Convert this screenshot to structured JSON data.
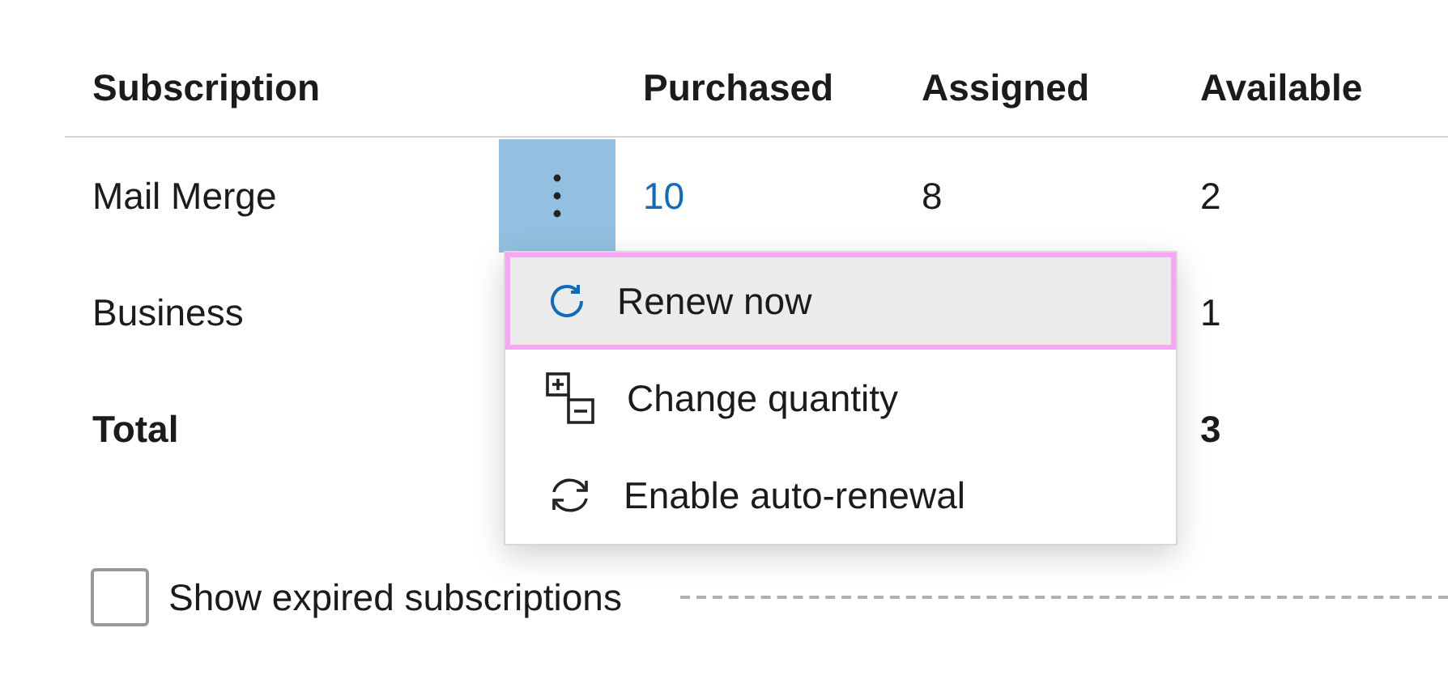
{
  "table": {
    "columns": [
      "Subscription",
      "Purchased",
      "Assigned",
      "Available"
    ],
    "rows": [
      {
        "kind": "item",
        "subscription": "Mail Merge",
        "has_more": true,
        "purchased": "10",
        "assigned": "8",
        "available": "2"
      },
      {
        "kind": "item",
        "subscription": "Business",
        "available": "1"
      },
      {
        "kind": "total",
        "subscription": "Total",
        "available": "3"
      }
    ]
  },
  "menu": {
    "items": [
      {
        "kind": "renew",
        "label": "Renew now",
        "selected": true
      },
      {
        "kind": "quantity",
        "label": "Change quantity",
        "selected": false
      },
      {
        "kind": "autorenew",
        "label": "Enable auto-renewal",
        "selected": false
      }
    ]
  },
  "show_expired": {
    "label": "Show expired subscriptions",
    "checked": false
  }
}
